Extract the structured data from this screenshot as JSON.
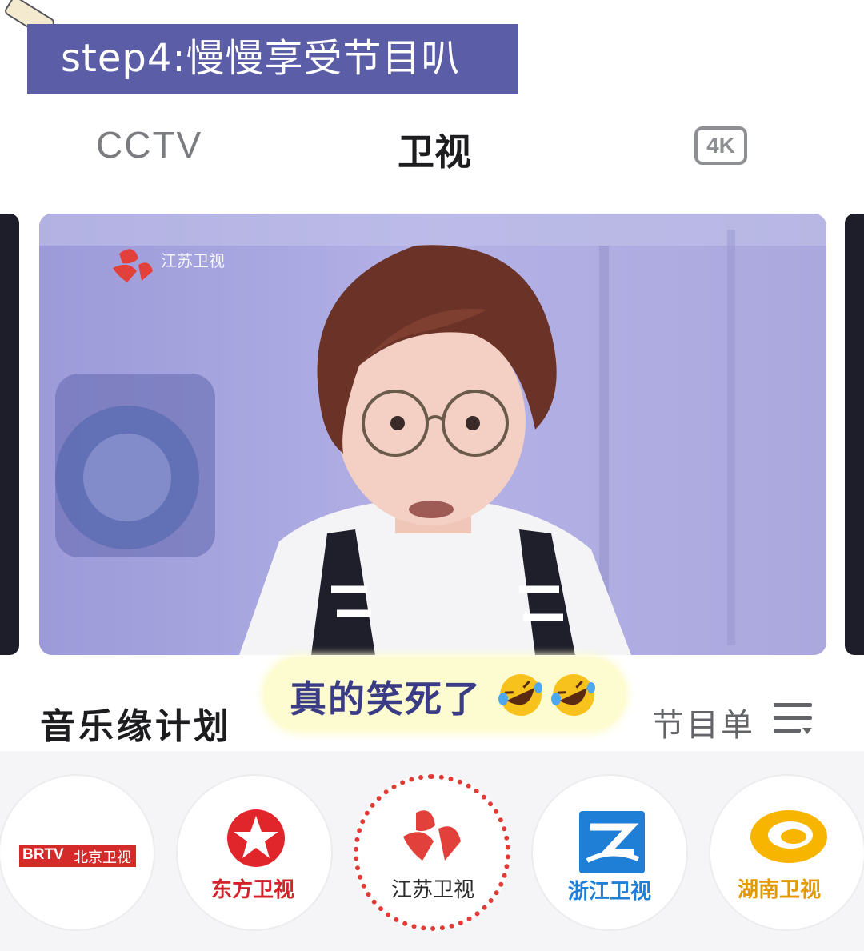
{
  "banner": {
    "text": "step4:慢慢享受节目叭"
  },
  "tabs": [
    {
      "label": "CCTV",
      "active": false
    },
    {
      "label": "卫视",
      "active": true
    },
    {
      "label": "4K",
      "active": false
    }
  ],
  "video": {
    "watermark": "江苏卫视"
  },
  "program": {
    "title": "音乐缘计划",
    "schedule_label": "节目单",
    "schedule_icon": "list-menu-icon"
  },
  "caption": {
    "text": "真的笑死了",
    "emoji": "rolling-on-floor-laughing"
  },
  "channels": [
    {
      "brand": "BRTV",
      "label": "北京卫视",
      "icon": "brtv-logo-icon",
      "selected": false
    },
    {
      "label": "东方卫视",
      "icon": "dragon-tv-star-icon",
      "selected": false
    },
    {
      "label": "江苏卫视",
      "icon": "jiangsu-tv-logo-icon",
      "selected": true
    },
    {
      "label": "浙江卫视",
      "icon": "zhejiang-tv-z-icon",
      "selected": false
    },
    {
      "label": "湖南卫视",
      "icon": "hunan-tv-mango-icon",
      "selected": false
    }
  ],
  "colors": {
    "banner": "#5b5da6",
    "selected_ring": "#e23b36",
    "caption_bg": "#fdfbd0",
    "caption_text": "#3b3c86"
  }
}
